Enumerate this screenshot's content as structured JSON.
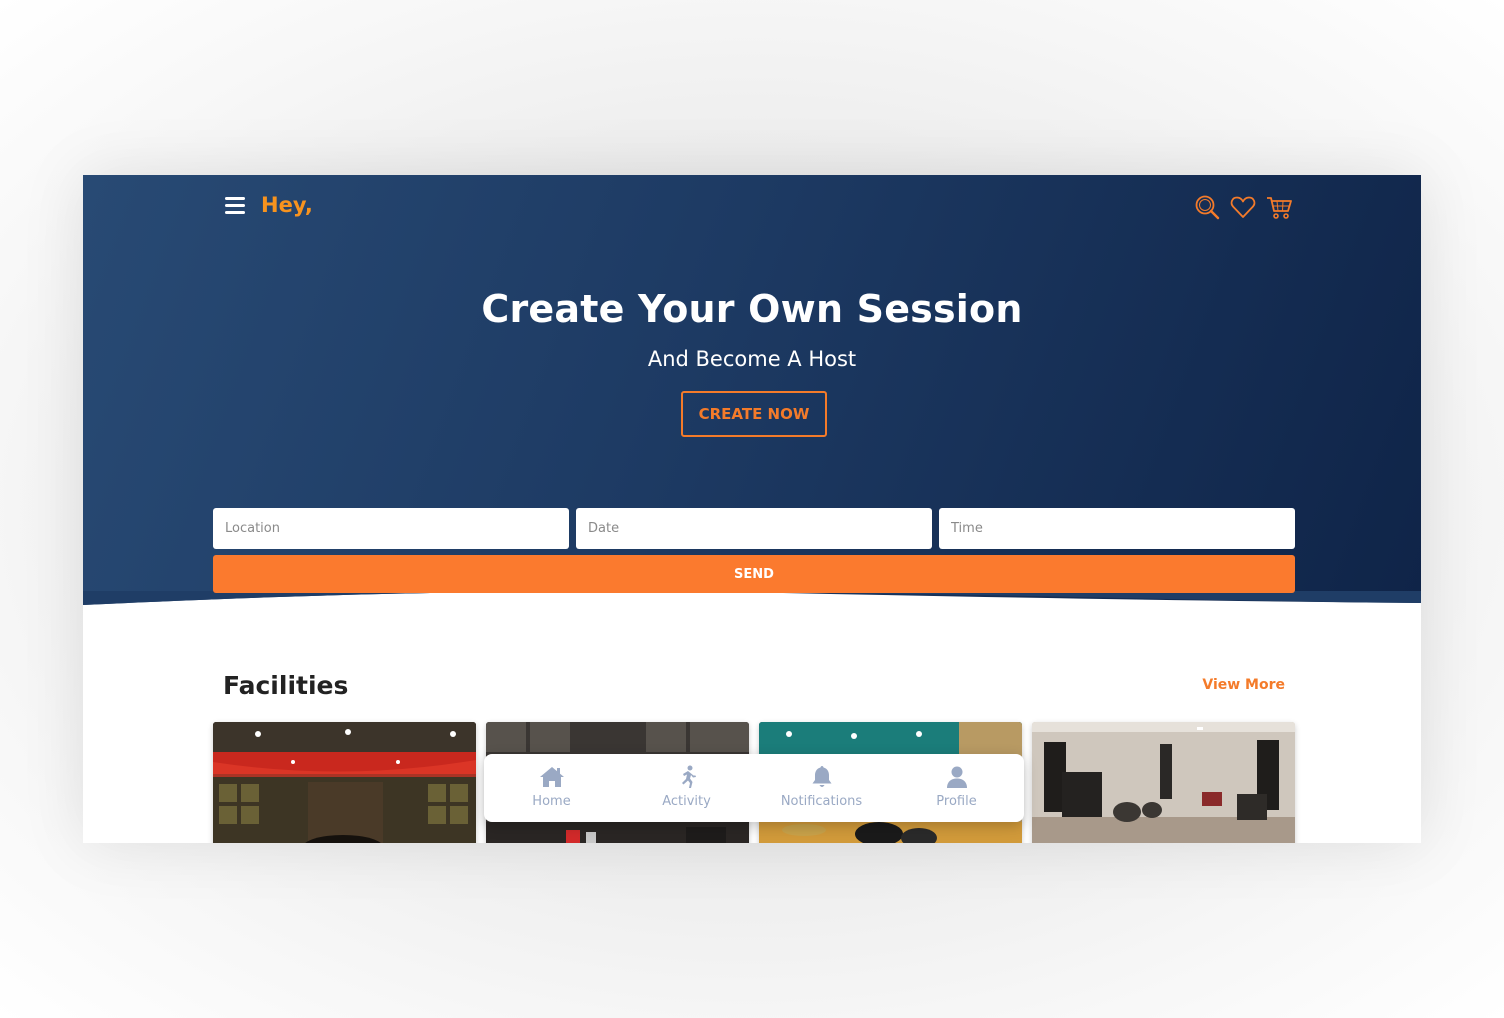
{
  "header": {
    "greeting": "Hey,",
    "icons": [
      "menu-icon",
      "search-icon",
      "heart-icon",
      "cart-icon"
    ]
  },
  "hero": {
    "title": "Create Your Own Session",
    "subtitle": "And Become A Host",
    "cta_label": "CREATE NOW"
  },
  "search": {
    "location_placeholder": "Location",
    "date_placeholder": "Date",
    "time_placeholder": "Time",
    "send_label": "SEND"
  },
  "facilities": {
    "title": "Facilities",
    "view_more": "View More",
    "cards": [
      "studio-photo-1",
      "studio-photo-2",
      "studio-photo-3",
      "studio-photo-4"
    ]
  },
  "bottom_nav": {
    "items": [
      {
        "label": "Home",
        "icon": "home-icon"
      },
      {
        "label": "Activity",
        "icon": "running-person-icon"
      },
      {
        "label": "Notifications",
        "icon": "bell-icon"
      },
      {
        "label": "Profile",
        "icon": "user-icon"
      }
    ]
  },
  "colors": {
    "accent": "#f47b2a",
    "greeting": "#f7931e",
    "hero_start": "#284a74",
    "hero_end": "#0f2448",
    "nav_inactive": "#9aa9c4"
  }
}
